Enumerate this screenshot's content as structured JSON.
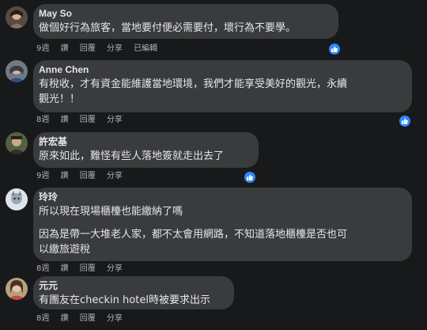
{
  "comments": [
    {
      "author": "May So",
      "paragraphs": [
        "做個好行為旅客，當地要付便必需要付，壞行為不要學。"
      ],
      "time": "9週",
      "like_label": "讚",
      "reply_label": "回覆",
      "share_label": "分享",
      "edited_label": "已編輯"
    },
    {
      "author": "Anne Chen",
      "paragraphs": [
        "有稅收，才有資金能維護當地環境，我們才能享受美好的觀光，永續",
        "觀光！！"
      ],
      "time": "8週",
      "like_label": "讚",
      "reply_label": "回覆",
      "share_label": "分享"
    },
    {
      "author": "許宏基",
      "paragraphs": [
        "原來如此，難怪有些人落地簽就走出去了"
      ],
      "time": "9週",
      "like_label": "讚",
      "reply_label": "回覆",
      "share_label": "分享"
    },
    {
      "author": "玲玲",
      "paragraphs": [
        "所以現在現場櫃檯也能繳納了嗎",
        "因為是帶一大堆老人家，都不太會用網路，不知道落地櫃檯是否也可",
        "以繳旅遊稅"
      ],
      "time": "8週",
      "like_label": "讚",
      "reply_label": "回覆",
      "share_label": "分享"
    },
    {
      "author": "元元",
      "paragraphs": [
        "有團友在checkin hotel時被要求出示"
      ],
      "time": "8週",
      "like_label": "讚",
      "reply_label": "回覆",
      "share_label": "分享"
    }
  ],
  "colors": {
    "background": "#18191a",
    "bubble": "#3a3b3c",
    "text": "#e4e6eb",
    "secondary_text": "#b0b3b8",
    "like_blue": "#2d88ff"
  },
  "icons": [
    "like-thumb-icon"
  ]
}
